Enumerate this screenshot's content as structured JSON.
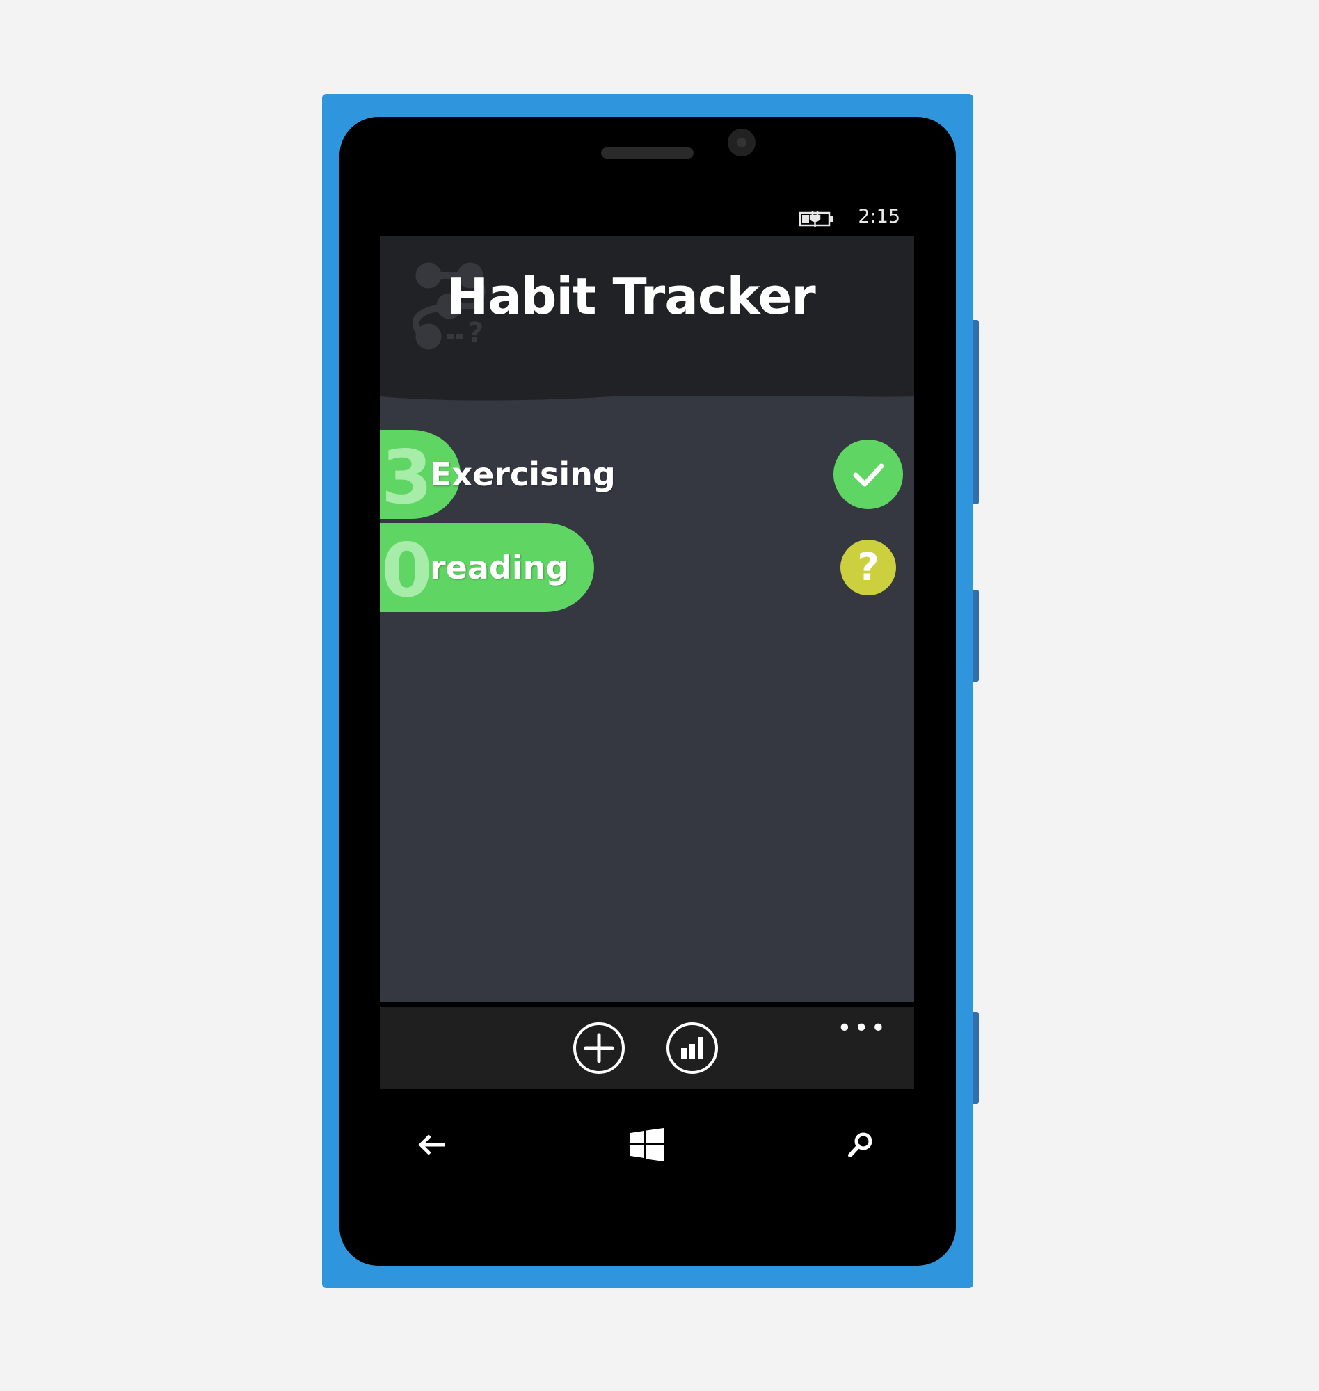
{
  "status_bar": {
    "time": "2:15",
    "battery_icon": "battery-charging-icon"
  },
  "header": {
    "title": "Habit Tracker",
    "logo_icon": "habit-tracker-logo-icon"
  },
  "habits": [
    {
      "streak": "3",
      "name": "Exercising",
      "status": "done",
      "status_icon": "checkmark-icon",
      "status_color": "#5fd563"
    },
    {
      "streak": "0",
      "name": "reading",
      "status": "unknown",
      "status_icon": "question-mark-icon",
      "status_label": "?",
      "status_color": "#cccf3e"
    }
  ],
  "app_bar": {
    "add_icon": "add-icon",
    "stats_icon": "bar-chart-icon",
    "more_label": "•••"
  },
  "hardware_nav": {
    "back_icon": "back-arrow-icon",
    "start_icon": "windows-logo-icon",
    "search_icon": "search-icon"
  },
  "colors": {
    "phone_frame": "#2f95dc",
    "header_bg": "#212226",
    "content_bg": "#353840",
    "app_bar_bg": "#1f1f1f",
    "accent_green": "#5fd563",
    "accent_yellow": "#cccf3e"
  }
}
